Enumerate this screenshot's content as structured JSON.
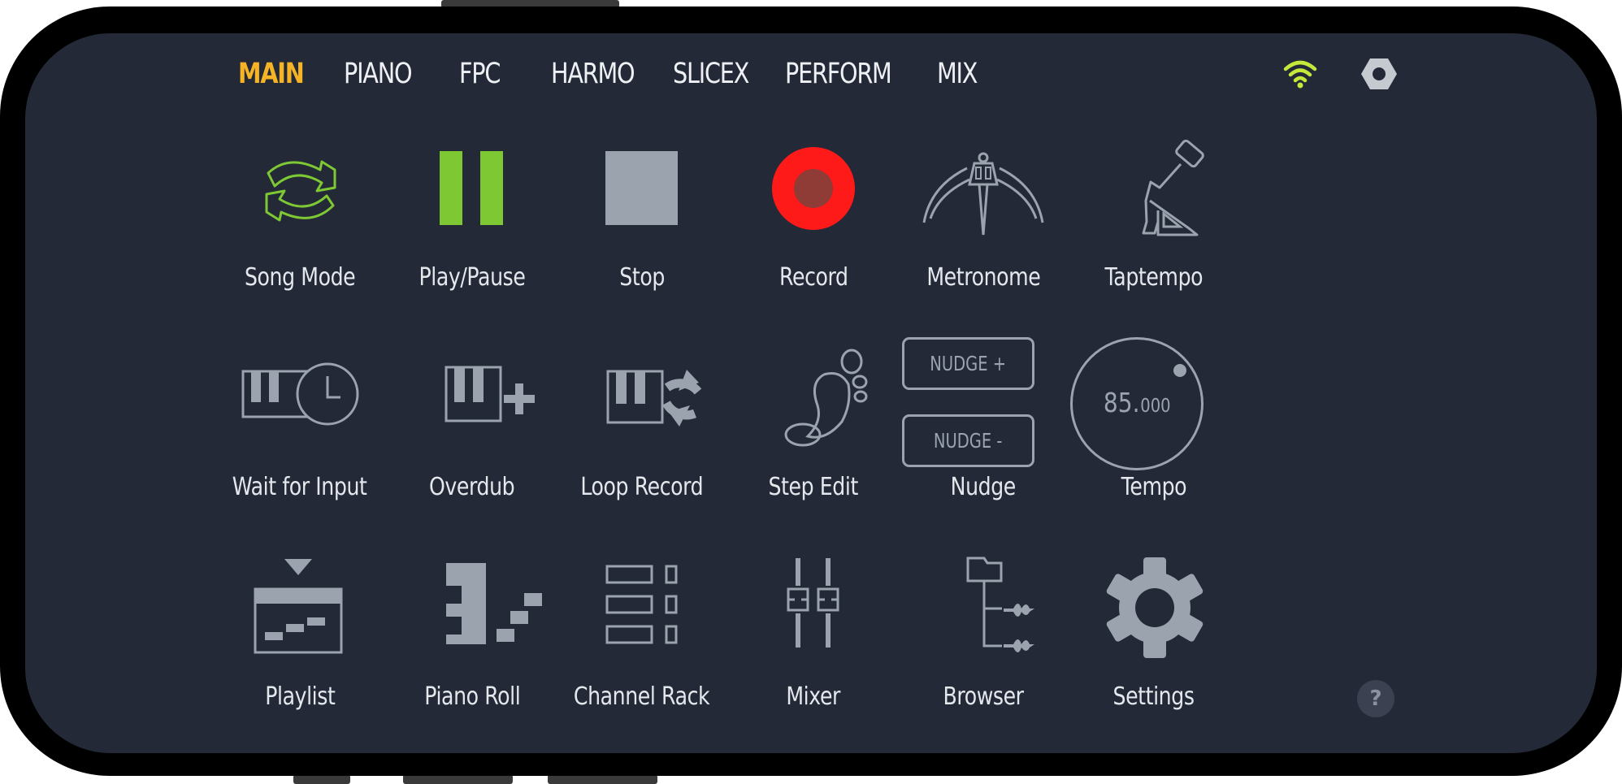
{
  "tabs": [
    {
      "label": "MAIN",
      "active": true
    },
    {
      "label": "PIANO"
    },
    {
      "label": "FPC"
    },
    {
      "label": "HARMO"
    },
    {
      "label": "SLICEX"
    },
    {
      "label": "PERFORM"
    },
    {
      "label": "MIX"
    }
  ],
  "status": {
    "wifi_icon": "wifi-icon",
    "settings_icon": "hex-nut-icon"
  },
  "transport": {
    "song_mode": "Song Mode",
    "play_pause": "Play/Pause",
    "stop": "Stop",
    "record": "Record",
    "metronome": "Metronome",
    "taptempo": "Taptempo"
  },
  "recording": {
    "wait_for_input": "Wait for Input",
    "overdub": "Overdub",
    "loop_record": "Loop Record",
    "step_edit": "Step Edit",
    "nudge": "Nudge",
    "nudge_plus": "NUDGE +",
    "nudge_minus": "NUDGE -",
    "tempo": "Tempo",
    "tempo_int": "85.",
    "tempo_frac": "000"
  },
  "windows": {
    "playlist": "Playlist",
    "piano_roll": "Piano Roll",
    "channel_rack": "Channel Rack",
    "mixer": "Mixer",
    "browser": "Browser",
    "settings": "Settings"
  },
  "help": "?",
  "colors": {
    "background": "#232937",
    "active_tab": "#f5b325",
    "accent_green": "#7ec933",
    "record_red": "#ff1a1a",
    "icon_gray": "#9aa3ae",
    "wifi": "#c6e83b"
  }
}
